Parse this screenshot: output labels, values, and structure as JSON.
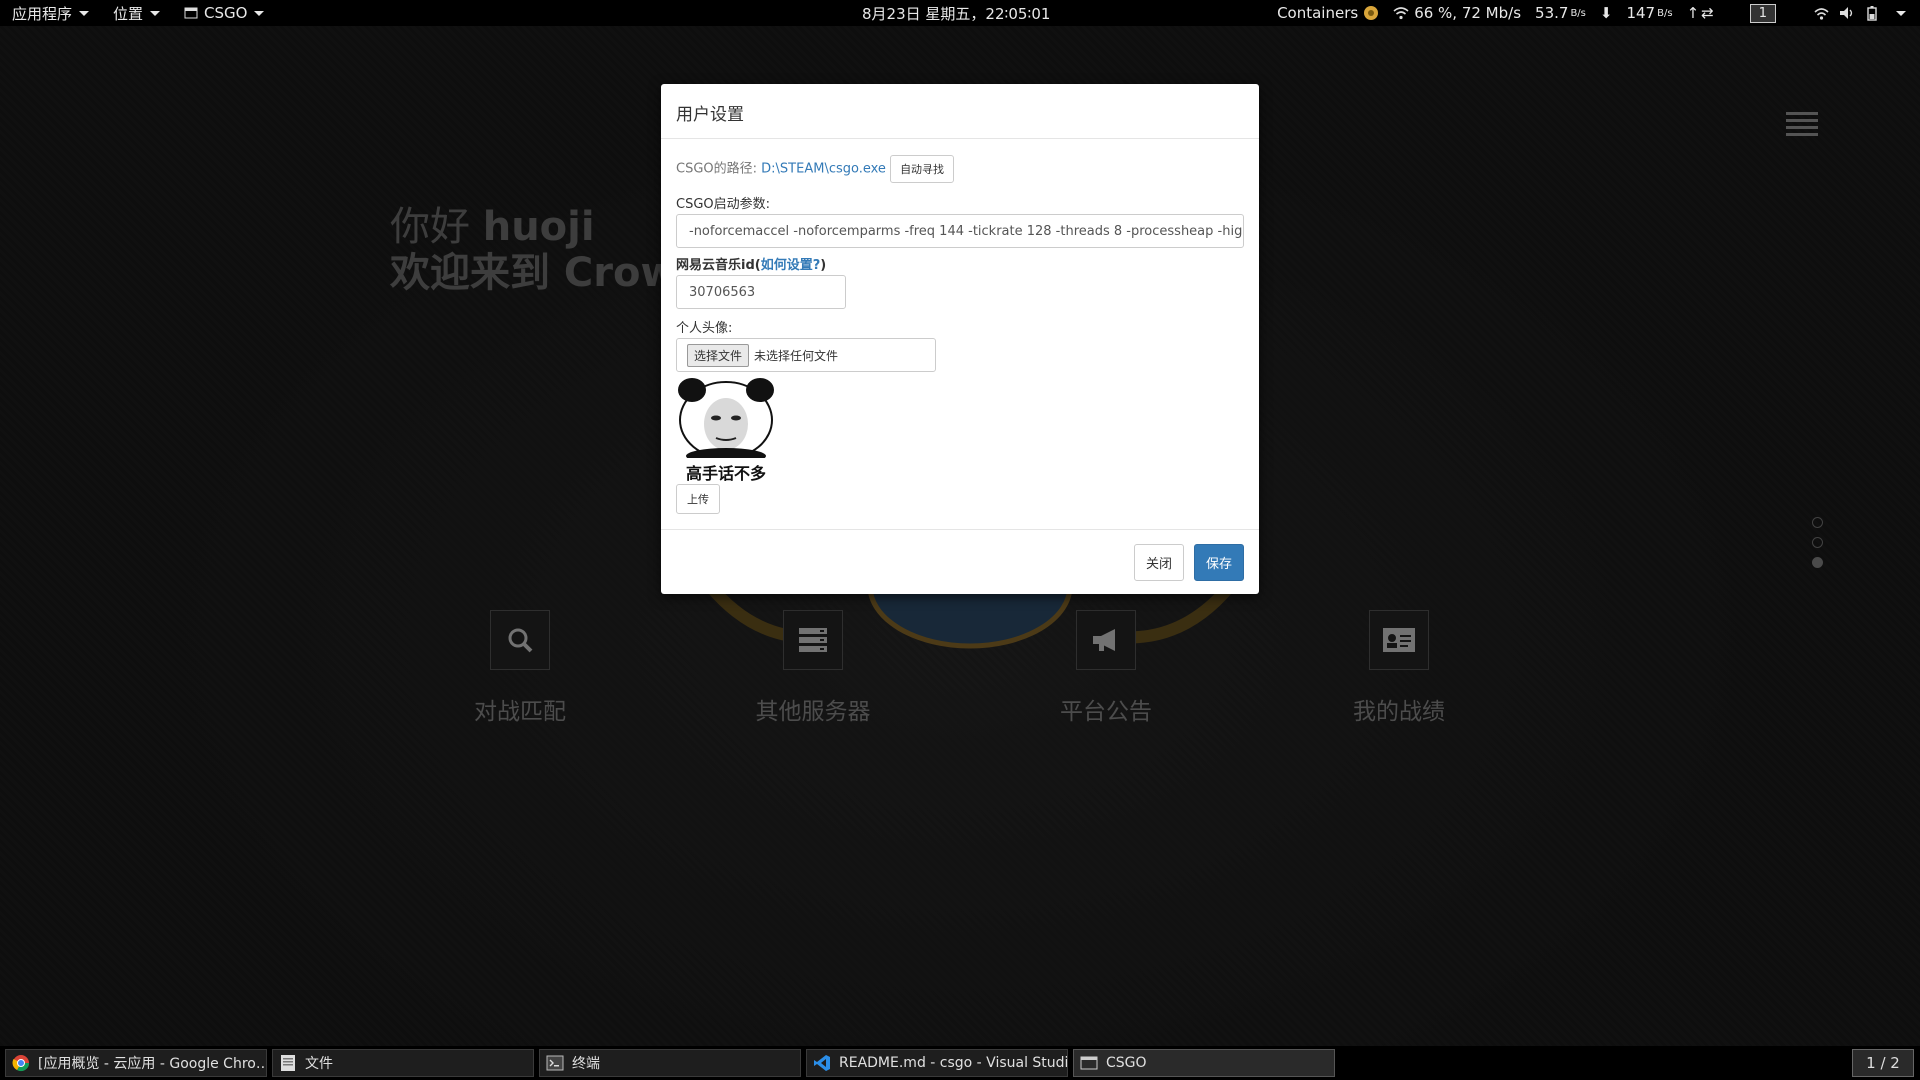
{
  "top_panel": {
    "apps_menu": "应用程序",
    "places_menu": "位置",
    "window_menu": "CSGO",
    "clock": "8月23日 星期五，22∶05∶01",
    "containers": "Containers",
    "wifi_text": "66 %, 72 Mb/s",
    "down_speed": "53.7",
    "down_unit": "B/s",
    "up_speed": "147",
    "up_unit": "B/s",
    "workspace": "1"
  },
  "app": {
    "greeting_prefix": "你好 ",
    "username": "huoji",
    "welcome_line": "欢迎来到 Crow",
    "features": [
      {
        "icon": "search-icon",
        "label": "对战匹配"
      },
      {
        "icon": "server-icon",
        "label": "其他服务器"
      },
      {
        "icon": "megaphone-icon",
        "label": "平台公告"
      },
      {
        "icon": "id-card-icon",
        "label": "我的战绩"
      }
    ]
  },
  "dialog": {
    "title": "用户设置",
    "csgo_path_label": "CSGO的路径:",
    "csgo_path_value": "D:\\STEAM\\csgo.exe",
    "auto_find_button": "自动寻找",
    "launch_params_label": "CSGO启动参数:",
    "launch_params_value": "-noforcemaccel -noforcemparms -freq 144 -tickrate 128 -threads 8 -processheap -high",
    "netease_label_prefix": "网易云音乐id(",
    "netease_help_link": "如何设置?",
    "netease_label_suffix": ")",
    "netease_id_value": "30706563",
    "avatar_label": "个人头像:",
    "choose_file_button": "选择文件",
    "no_file_text": "未选择任何文件",
    "avatar_caption": "高手话不多",
    "upload_button": "上传",
    "close_button": "关闭",
    "save_button": "保存"
  },
  "taskbar": {
    "tasks": [
      {
        "icon": "chrome-icon",
        "label": "[应用概览 - 云应用 - Google Chro…"
      },
      {
        "icon": "files-icon",
        "label": "文件"
      },
      {
        "icon": "terminal-icon",
        "label": "终端"
      },
      {
        "icon": "vscode-icon",
        "label": "README.md - csgo - Visual Studi…"
      },
      {
        "icon": "window-icon",
        "label": "CSGO"
      }
    ],
    "pager": "1 / 2"
  }
}
